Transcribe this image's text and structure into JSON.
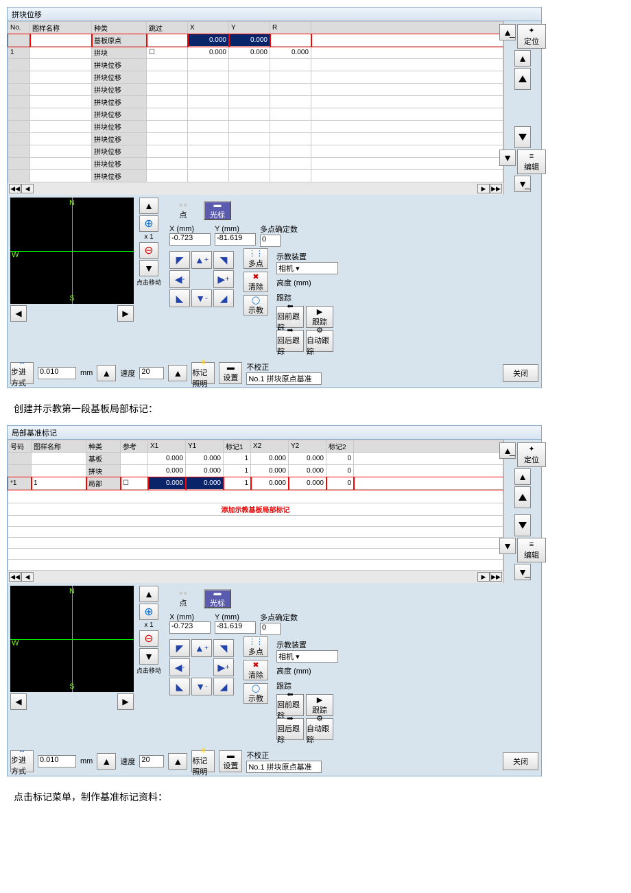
{
  "panel1": {
    "title": "拼块位移",
    "headers": [
      "No.",
      "图样名称",
      "种类",
      "跳过",
      "X",
      "Y",
      "R"
    ],
    "rows": [
      {
        "no": "",
        "name": "",
        "type": "基板原点",
        "skip": "",
        "x": "0.000",
        "y": "0.000",
        "r": "",
        "hl": true,
        "red": true
      },
      {
        "no": "1",
        "name": "",
        "type": "拼块",
        "skip": "☐",
        "x": "0.000",
        "y": "0.000",
        "r": "0.000"
      },
      {
        "type": "拼块位移"
      },
      {
        "type": "拼块位移"
      },
      {
        "type": "拼块位移"
      },
      {
        "type": "拼块位移"
      },
      {
        "type": "拼块位移"
      },
      {
        "type": "拼块位移"
      },
      {
        "type": "拼块位移"
      },
      {
        "type": "拼块位移"
      },
      {
        "type": "拼块位移"
      },
      {
        "type": "拼块位移"
      }
    ]
  },
  "panel2": {
    "title": "局部基准标记",
    "headers": [
      "号码",
      "图样名称",
      "种类",
      "参考",
      "X1",
      "Y1",
      "标记1",
      "X2",
      "Y2",
      "标记2"
    ],
    "rows": [
      {
        "n": "",
        "name": "",
        "t": "基板",
        "r": "",
        "x1": "0.000",
        "y1": "0.000",
        "m1": "1",
        "x2": "0.000",
        "y2": "0.000",
        "m2": "0"
      },
      {
        "n": "",
        "name": "",
        "t": "拼块",
        "r": "",
        "x1": "0.000",
        "y1": "0.000",
        "m1": "1",
        "x2": "0.000",
        "y2": "0.000",
        "m2": "0"
      },
      {
        "n": "*1",
        "name": "1",
        "t": "局部",
        "r": "☐",
        "x1": "0.000",
        "y1": "0.000",
        "m1": "1",
        "x2": "0.000",
        "y2": "0.000",
        "m2": "0",
        "red": true,
        "hl": true
      }
    ],
    "note": "添加示教基板局部标记"
  },
  "side": {
    "locate": "定位",
    "edit": "编辑"
  },
  "ctrl": {
    "dot": "点",
    "cursor": "光标",
    "xlabel": "X (mm)",
    "ylabel": "Y (mm)",
    "xval": "-0.723",
    "yval": "-81.619",
    "multi_label": "多点确定数",
    "multi_val": "0",
    "click_move": "点击移动",
    "x1": "x 1",
    "multi": "多点",
    "clear": "清除",
    "teach": "示教",
    "device_label": "示教装置",
    "device_val": "相机",
    "height": "高度 (mm)",
    "track": "跟踪",
    "t1": "回前跟踪",
    "t2": "跟踪",
    "t3": "回后跟踪",
    "t4": "自动跟踪"
  },
  "bottom": {
    "step": "步进方式",
    "step_val": "0.010",
    "step_unit": "mm",
    "speed": "速度",
    "speed_val": "20",
    "mark_light": "标记照明",
    "settings": "设置",
    "nocorr": "不校正",
    "ref": "No.1 拼块原点基准",
    "close": "关闭"
  },
  "text1": "创建并示教第一段基板局部标记：",
  "text2": "点击标记菜单，制作基准标记资料："
}
